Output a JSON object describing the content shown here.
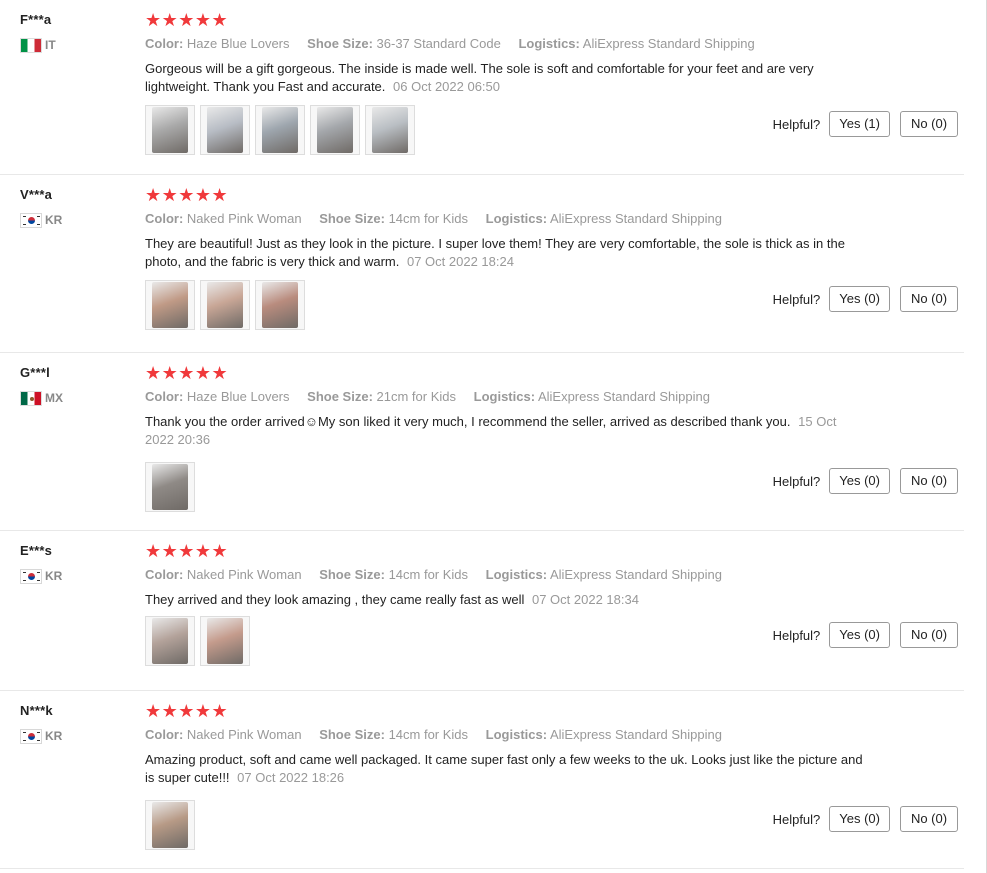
{
  "colors": {
    "star": "#f0393b",
    "muted_text": "#999999",
    "body_text": "#222222",
    "divider": "#e8e8e8"
  },
  "labels": {
    "color": "Color:",
    "shoe_size": "Shoe Size:",
    "logistics": "Logistics:",
    "helpful": "Helpful?",
    "stars": "★★★★★"
  },
  "reviews": [
    {
      "user": "F***a",
      "country": "IT",
      "flag_icon": "italy-flag-icon",
      "rating": 5,
      "color": "Haze Blue Lovers",
      "shoe_size": "36-37 Standard Code",
      "logistics": "AliExpress Standard Shipping",
      "text": "Gorgeous will be a gift gorgeous. The inside is made well. The sole is soft and comfortable for your feet and are very lightweight. Thank you Fast and accurate.",
      "date": "06 Oct 2022 06:50",
      "photos": [
        "#a9a9a9",
        "#b7bcc4",
        "#9ea6ae",
        "#a4a7ab",
        "#b9bec3"
      ],
      "yes_label": "Yes (1)",
      "no_label": "No (0)"
    },
    {
      "user": "V***a",
      "country": "KR",
      "flag_icon": "korea-flag-icon",
      "rating": 5,
      "color": "Naked Pink Woman",
      "shoe_size": "14cm for Kids",
      "logistics": "AliExpress Standard Shipping",
      "text": "They are beautiful! Just as they look in the picture. I super love them! They are very comfortable, the sole is thick as in the photo, and the fabric is very thick and warm.",
      "date": "07 Oct 2022 18:24",
      "photos": [
        "#c09a86",
        "#c8a696",
        "#b98c7e"
      ],
      "yes_label": "Yes (0)",
      "no_label": "No (0)"
    },
    {
      "user": "G***l",
      "country": "MX",
      "flag_icon": "mexico-flag-icon",
      "rating": 5,
      "color": "Haze Blue Lovers",
      "shoe_size": "21cm for Kids",
      "logistics": "AliExpress Standard Shipping",
      "text": "Thank you the order arrived☺My son liked it very much, I recommend the seller, arrived as described thank you.",
      "date": "15 Oct 2022 20:36",
      "photos": [
        "#8f8a86"
      ],
      "yes_label": "Yes (0)",
      "no_label": "No (0)"
    },
    {
      "user": "E***s",
      "country": "KR",
      "flag_icon": "korea-flag-icon",
      "rating": 5,
      "color": "Naked Pink Woman",
      "shoe_size": "14cm for Kids",
      "logistics": "AliExpress Standard Shipping",
      "text": "They arrived and they look amazing , they came really fast as well",
      "date": "07 Oct 2022 18:34",
      "photos": [
        "#b3a29a",
        "#c49b8c"
      ],
      "yes_label": "Yes (0)",
      "no_label": "No (0)"
    },
    {
      "user": "N***k",
      "country": "KR",
      "flag_icon": "korea-flag-icon",
      "rating": 5,
      "color": "Naked Pink Woman",
      "shoe_size": "14cm for Kids",
      "logistics": "AliExpress Standard Shipping",
      "text": "Amazing product, soft and came well packaged. It came super fast only a few weeks to the uk. Looks just like the picture and is super cute!!!",
      "date": "07 Oct 2022 18:26",
      "photos": [
        "#b79a86"
      ],
      "yes_label": "Yes (0)",
      "no_label": "No (0)"
    }
  ]
}
